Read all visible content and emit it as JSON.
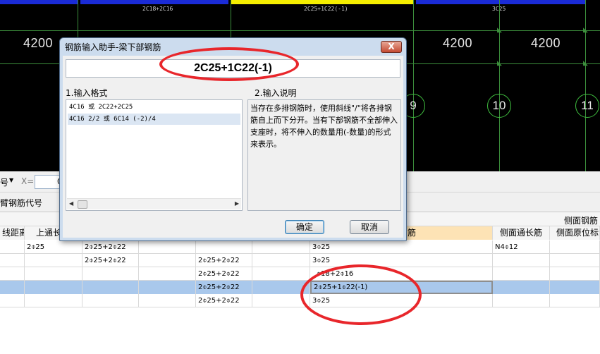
{
  "cad": {
    "beam_labels": [
      "2C18+2C16",
      "2C25+1C22(-1)",
      "3C25"
    ],
    "dimensions": [
      "4200",
      "4200",
      "4200"
    ],
    "axis_numbers": [
      "9",
      "10",
      "11"
    ]
  },
  "toolbar": {
    "dropdown_char": "号",
    "x_label": "X=",
    "x_value": "0",
    "cantilever_label": "臂钢筋代号"
  },
  "table": {
    "header_top_right": "侧面钢筋",
    "headers": [
      "线距离",
      "上通长",
      "",
      "",
      "",
      "",
      "筋",
      "侧面通长筋",
      "侧面原位标注"
    ],
    "rows": [
      [
        "",
        "2⌽25",
        "2⌽25+2⌽22",
        "",
        "",
        "",
        "3⌽25",
        "N4⌽12",
        ""
      ],
      [
        "",
        "",
        "2⌽25+2⌽22",
        "",
        "2⌽25+2⌽22",
        "",
        "3⌽25",
        "",
        ""
      ],
      [
        "",
        "",
        "",
        "",
        "2⌽25+2⌽22",
        "",
        "⌽18+2⌽16",
        "",
        ""
      ],
      [
        "",
        "",
        "",
        "",
        "2⌽25+2⌽22",
        "",
        "2⌽25+1⌽22(-1)",
        "",
        ""
      ],
      [
        "",
        "",
        "",
        "",
        "2⌽25+2⌽22",
        "",
        "3⌽25",
        "",
        ""
      ]
    ]
  },
  "dialog": {
    "title": "钢筋输入助手-梁下部钢筋",
    "close_label": "X",
    "value": "2C25+1C22(-1)",
    "format_label": "1.输入格式",
    "desc_label": "2.输入说明",
    "formats": [
      "4C16 或 2C22+2C25",
      "4C16 2/2 或 6C14 (-2)/4"
    ],
    "description": "当存在多排钢筋时，使用斜线\"/\"将各排钢筋自上而下分开。当有下部钢筋不全部伸入支座时，将不伸入的数量用(-数量)的形式来表示。",
    "ok_label": "确定",
    "cancel_label": "取消"
  },
  "colors": {
    "annotation_red": "#e8262b",
    "grid_green": "#3c8f3c",
    "selected_row": "#a9c8ec"
  }
}
